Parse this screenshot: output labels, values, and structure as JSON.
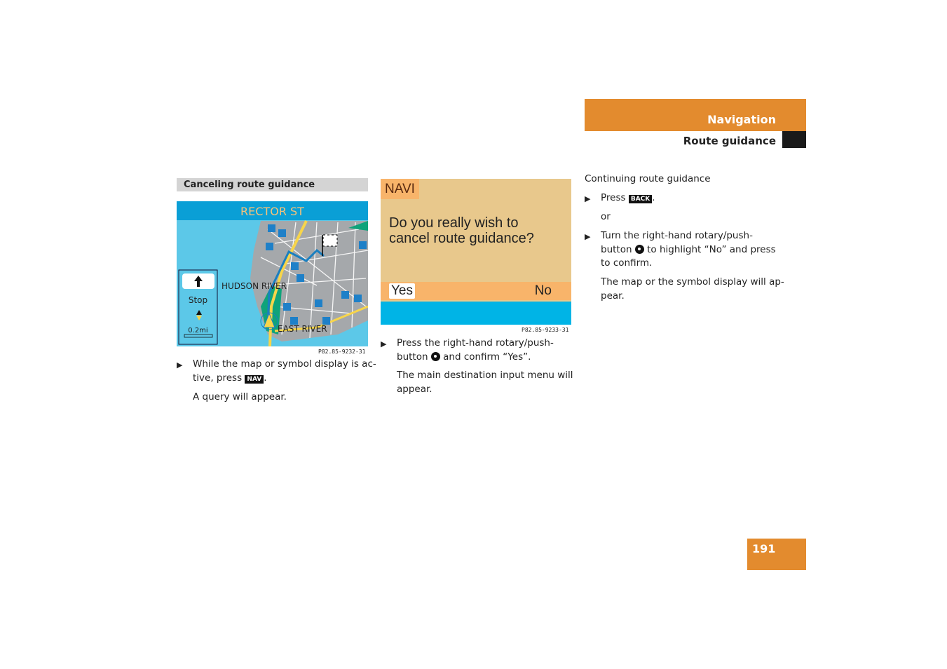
{
  "header": {
    "section": "Navigation",
    "subsection": "Route guidance"
  },
  "colors": {
    "accent": "#E38B2E",
    "map_title_bar": "#0A9FD6",
    "dialog_bg": "#E8C88C",
    "dialog_option_bar": "#F8B46A",
    "screen_blue": "#00B4E6"
  },
  "col1": {
    "heading": "Canceling route guidance",
    "map": {
      "street": "RECTOR ST",
      "label_river1": "HUDSON RIVER",
      "label_river2": "EAST RIVER",
      "turn_status": "Stop",
      "distance": "0.2mi",
      "parking_label": "P"
    },
    "caption": "P82.85-9232-31",
    "step1_a": "While the map or symbol display is ac-",
    "step1_b": "tive, press",
    "key_nav": "NAV",
    "step1_end": ".",
    "result": "A query will appear."
  },
  "col2": {
    "dialog": {
      "title": "NAVI",
      "line1": "Do you really wish to",
      "line2": "cancel route guidance?",
      "yes": "Yes",
      "no": "No"
    },
    "caption": "P82.85-9233-31",
    "step1_a": "Press the right-hand rotary/push-",
    "step1_b": "button",
    "step1_c": "and confirm “Yes”.",
    "result_a": "The main destination input menu will",
    "result_b": "appear."
  },
  "col3": {
    "heading": "Continuing route guidance",
    "step1": "Press",
    "key_back": "BACK",
    "step1_end": ".",
    "or": "or",
    "step2_a": "Turn the right-hand rotary/push-",
    "step2_b": "button",
    "step2_c": "to highlight “No” and press",
    "step2_d": "to confirm.",
    "result_a": "The map or the symbol display will ap-",
    "result_b": "pear."
  },
  "page_number": "191"
}
